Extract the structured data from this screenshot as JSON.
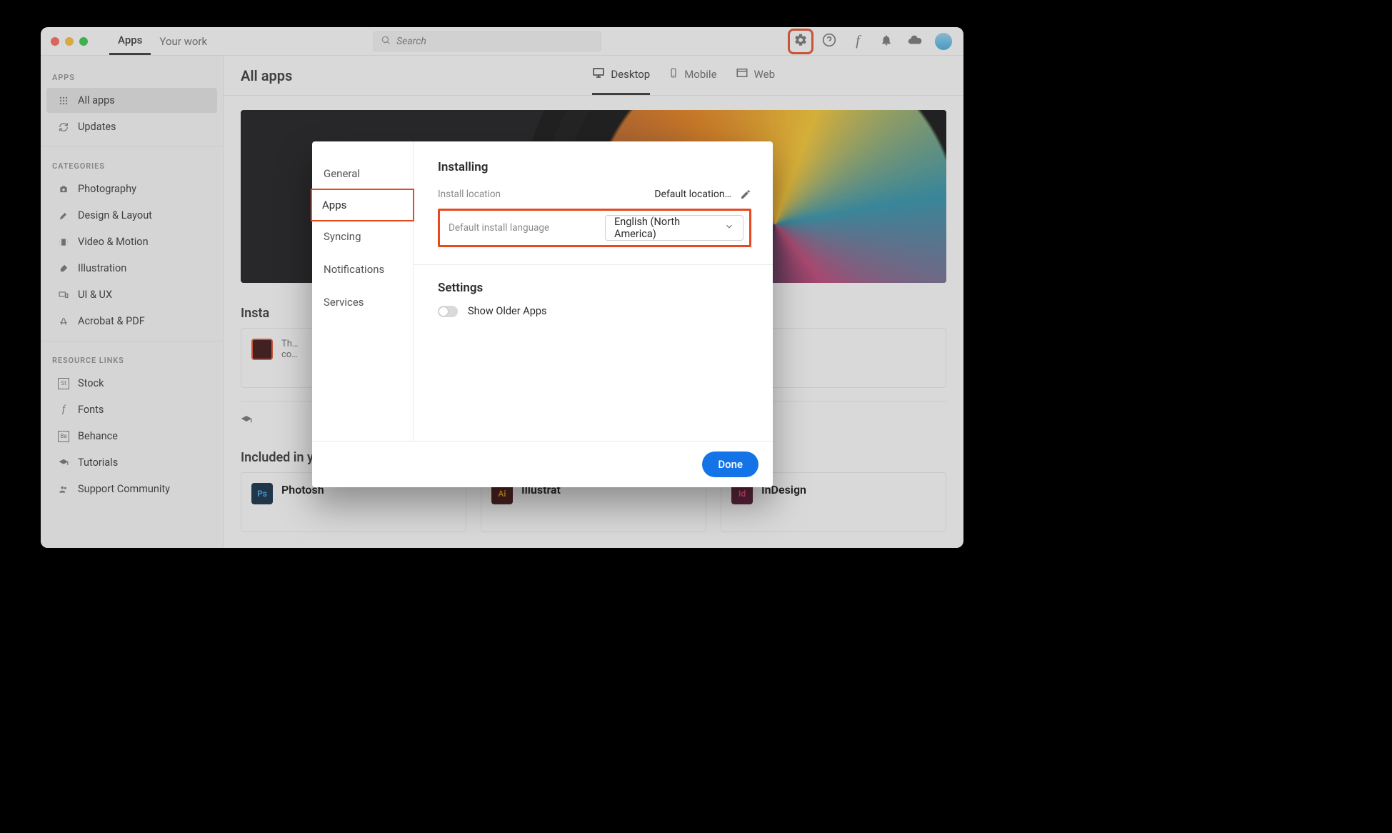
{
  "topbar": {
    "tabs": [
      {
        "label": "Apps",
        "active": true
      },
      {
        "label": "Your work",
        "active": false
      }
    ],
    "search_placeholder": "Search"
  },
  "sidebar": {
    "section_apps": "APPS",
    "apps": [
      {
        "label": "All apps"
      },
      {
        "label": "Updates"
      }
    ],
    "section_categories": "CATEGORIES",
    "categories": [
      {
        "label": "Photography"
      },
      {
        "label": "Design & Layout"
      },
      {
        "label": "Video & Motion"
      },
      {
        "label": "Illustration"
      },
      {
        "label": "UI & UX"
      },
      {
        "label": "Acrobat & PDF"
      }
    ],
    "section_links": "RESOURCE LINKS",
    "links": [
      {
        "label": "Stock"
      },
      {
        "label": "Fonts"
      },
      {
        "label": "Behance"
      },
      {
        "label": "Tutorials"
      },
      {
        "label": "Support Community"
      }
    ]
  },
  "main": {
    "title": "All apps",
    "platforms": [
      {
        "label": "Desktop",
        "active": true
      },
      {
        "label": "Mobile",
        "active": false
      },
      {
        "label": "Web",
        "active": false
      }
    ],
    "installed_title": "Insta",
    "included_title": "Included in your subscription",
    "cards": [
      {
        "code": "Ps",
        "name": "Photosh",
        "bg": "#001e36",
        "fg": "#31a8ff"
      },
      {
        "code": "Ai",
        "name": "Illustrat",
        "bg": "#330000",
        "fg": "#ff9a00"
      },
      {
        "code": "Id",
        "name": "InDesign",
        "bg": "#49021f",
        "fg": "#ff3366"
      }
    ]
  },
  "modal": {
    "side": [
      {
        "label": "General"
      },
      {
        "label": "Apps"
      },
      {
        "label": "Syncing"
      },
      {
        "label": "Notifications"
      },
      {
        "label": "Services"
      }
    ],
    "installing": {
      "heading": "Installing",
      "location_label": "Install location",
      "location_value": "Default location…",
      "language_label": "Default install language",
      "language_value": "English (North America)"
    },
    "settings": {
      "heading": "Settings",
      "show_older": "Show Older Apps"
    },
    "done": "Done"
  }
}
